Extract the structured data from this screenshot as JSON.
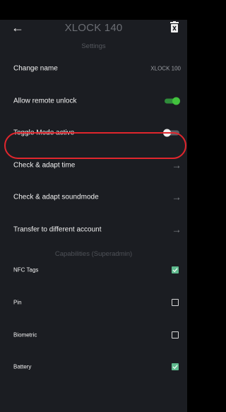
{
  "header": {
    "back_icon": "arrow-left-icon",
    "title": "XLOCK 140",
    "subtitle": "Settings",
    "delete_icon": "trash-icon"
  },
  "settings": [
    {
      "label": "Change name",
      "value": "XLOCK 100"
    },
    {
      "label": "Allow remote unlock",
      "toggle": "on"
    },
    {
      "label": "Toggle Mode active",
      "toggle": "off"
    },
    {
      "label": "Check & adapt time",
      "icon": "arrow-right-icon",
      "highlighted": true
    },
    {
      "label": "Check & adapt soundmode",
      "icon": "arrow-right-icon"
    },
    {
      "label": "Transfer to different account",
      "icon": "arrow-right-icon"
    }
  ],
  "capabilities": {
    "title": "Capabilities (Superadmin)",
    "items": [
      {
        "label": "NFC Tags",
        "checked": true
      },
      {
        "label": "Pin",
        "checked": false
      },
      {
        "label": "Biometric",
        "checked": false
      },
      {
        "label": "Battery",
        "checked": true
      }
    ]
  },
  "colors": {
    "background": "#1b1d22",
    "toggle_on": "#42c23d",
    "checkbox_checked": "#5fba8e",
    "highlight": "#e1262d"
  }
}
